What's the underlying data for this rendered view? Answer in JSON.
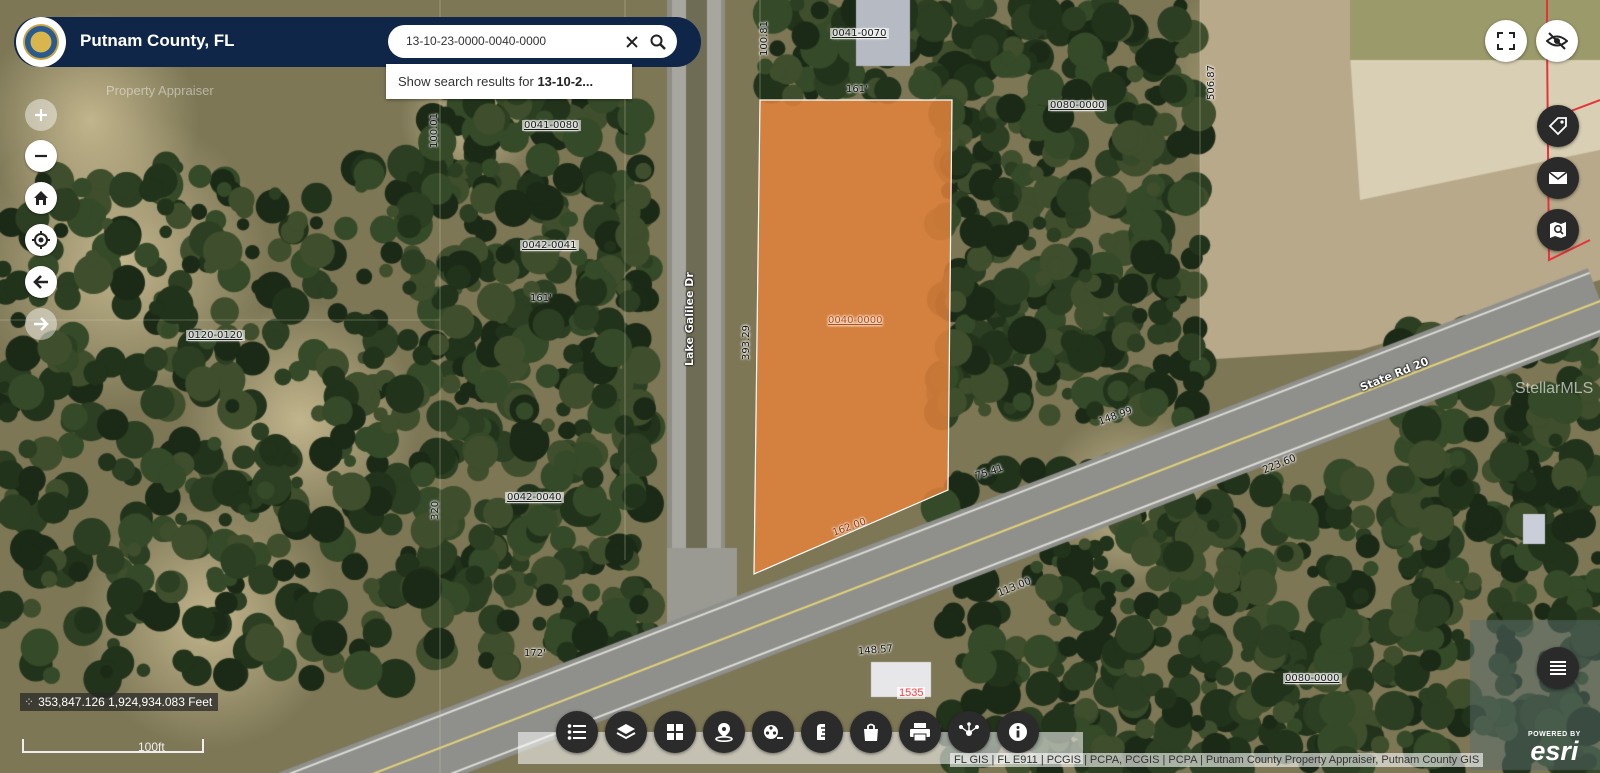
{
  "app": {
    "title": "Putnam County, FL",
    "watermark": "Property Appraiser"
  },
  "search": {
    "value": "13-10-23-0000-0040-0000",
    "suggestion_prefix": "Show search results for ",
    "suggestion_term": "13-10-2..."
  },
  "map": {
    "parcels": {
      "p0041_0070": "0041-0070",
      "p0041_0080": "0041-0080",
      "p0042_0041": "0042-0041",
      "p0042_0040": "0042-0040",
      "p0120_0120": "0120-0120",
      "p0080_0000_a": "0080-0000",
      "p0080_0000_b": "0080-0000",
      "selected": "0040-0000"
    },
    "dimensions": {
      "d161_top": "161'",
      "d161_left": "161'",
      "d393": "393.29",
      "d14899": "148.99",
      "d7541": "75.41",
      "d50687": "506.87",
      "d10001": "100.01",
      "d10081": "100.81",
      "d320": "320",
      "d172": "172'",
      "d14857": "148.57",
      "d22360": "223.60",
      "d11300": "113.00",
      "d16200": "162.00"
    },
    "roads": {
      "lake_galilee": "Lake Galilee Dr",
      "state_rd_20": "State Rd 20"
    },
    "house_number": "1535",
    "selected_fill": "#e8823a",
    "parcel_line_color": "#e8323a"
  },
  "coords": "353,847.126 1,924,934.083 Feet",
  "scale_label": "100ft",
  "attribution": "FL GIS | FL E911 | PCGIS | PCPA, PCGIS | PCPA | Putnam County Property Appraiser, Putnam County GIS",
  "esri": {
    "powered_by": "POWERED BY",
    "brand": "esri"
  },
  "stellar_watermark": "StellarMLS",
  "left_tools": [
    {
      "name": "zoom-in",
      "icon": "plus-icon",
      "enabled": false
    },
    {
      "name": "zoom-out",
      "icon": "minus-icon",
      "enabled": true
    },
    {
      "name": "home",
      "icon": "home-icon",
      "enabled": true
    },
    {
      "name": "locate",
      "icon": "locate-icon",
      "enabled": true
    },
    {
      "name": "previous-extent",
      "icon": "arrow-left-icon",
      "enabled": true
    },
    {
      "name": "next-extent",
      "icon": "arrow-right-icon",
      "enabled": false
    }
  ],
  "right_tools": [
    "fullscreen-icon",
    "hide-icon",
    "tag-icon",
    "mail-icon",
    "map-search-icon",
    "list-icon"
  ],
  "bottom_tools": [
    "list-icon",
    "layers-icon",
    "grid-icon",
    "map-pin-icon",
    "film-icon",
    "ruler-icon",
    "bag-icon",
    "print-icon",
    "share-icon",
    "info-icon"
  ]
}
